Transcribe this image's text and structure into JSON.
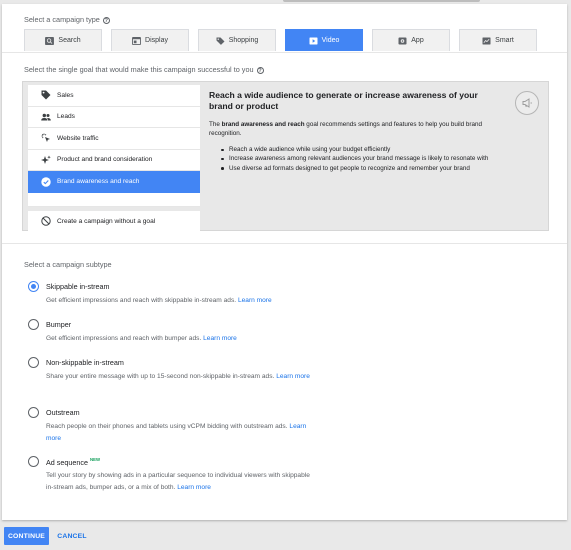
{
  "campaign_type": {
    "label": "Select a campaign type",
    "help_icon": "?",
    "tabs": [
      {
        "label": "Search",
        "icon": "search-icon"
      },
      {
        "label": "Display",
        "icon": "display-icon"
      },
      {
        "label": "Shopping",
        "icon": "shopping-tag-icon"
      },
      {
        "label": "Video",
        "icon": "video-icon",
        "active": true
      },
      {
        "label": "App",
        "icon": "app-icon"
      },
      {
        "label": "Smart",
        "icon": "smart-icon"
      }
    ]
  },
  "goal": {
    "label": "Select the single goal that would make this campaign successful to you",
    "help_icon": "?",
    "items": [
      {
        "label": "Sales",
        "icon": "tag-icon"
      },
      {
        "label": "Leads",
        "icon": "people-icon"
      },
      {
        "label": "Website traffic",
        "icon": "cursor-click-icon"
      },
      {
        "label": "Product and brand consideration",
        "icon": "sparkle-icon"
      },
      {
        "label": "Brand awareness and reach",
        "icon": "check-circle-icon",
        "selected": true
      }
    ],
    "no_goal_label": "Create a campaign without a goal",
    "detail": {
      "title": "Reach a wide audience to generate or increase awareness of your brand or product",
      "desc_prefix": "The ",
      "desc_bold": "brand awareness and reach",
      "desc_suffix": " goal recommends settings and features to help you build brand recognition.",
      "bullets": [
        "Reach a wide audience while using your budget efficiently",
        "Increase awareness among relevant audiences your brand message is likely to resonate with",
        "Use diverse ad formats designed to get people to recognize and remember your brand"
      ],
      "badge_icon": "megaphone-icon"
    }
  },
  "subtype": {
    "label": "Select a campaign subtype",
    "options": [
      {
        "title": "Skippable in-stream",
        "desc": "Get efficient impressions and reach with skippable in-stream ads.",
        "link": "Learn more",
        "checked": true
      },
      {
        "title": "Bumper",
        "desc": "Get efficient impressions and reach with bumper ads.",
        "link": "Learn more",
        "checked": false
      },
      {
        "title": "Non-skippable in-stream",
        "desc": "Share your entire message with up to 15-second non-skippable in-stream ads.",
        "link": "Learn more",
        "checked": false
      },
      {
        "title": "Outstream",
        "desc": "Reach people on their phones and tablets using vCPM bidding with outstream ads.",
        "link": "Learn more",
        "checked": false
      },
      {
        "title": "Ad sequence",
        "badge": "NEW",
        "desc": "Tell your story by showing ads in a particular sequence to individual viewers with skippable in-stream ads, bumper ads, or a mix of both.",
        "link": "Learn more",
        "checked": false
      }
    ]
  },
  "footer": {
    "continue_label": "CONTINUE",
    "cancel_label": "CANCEL"
  },
  "colors": {
    "accent": "#4285f4",
    "link": "#1a73e8",
    "new_badge": "#0f9d58"
  }
}
